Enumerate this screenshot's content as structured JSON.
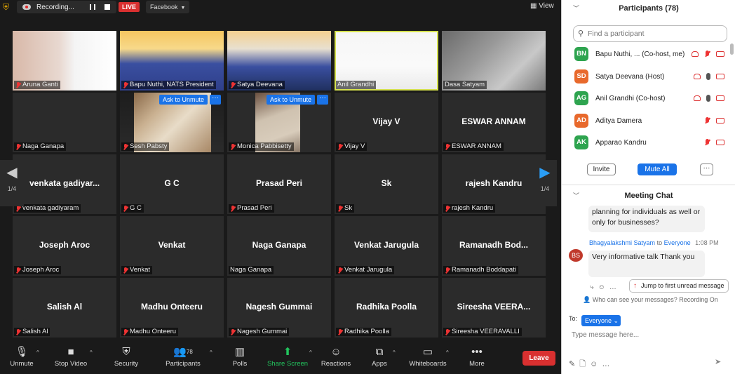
{
  "topbar": {
    "recording_label": "Recording...",
    "live_label": "LIVE",
    "platform_label": "Facebook",
    "view_label": "View"
  },
  "tiles": [
    {
      "name": "Aruna Ganti"
    },
    {
      "name": "Bapu Nuthi, NATS President"
    },
    {
      "name": "Satya Deevana"
    },
    {
      "name": "Anil Grandhi"
    },
    {
      "name": "Dasa Satyam"
    },
    {
      "name": "Naga Ganapa"
    },
    {
      "name": "Sesh Pabsty",
      "ask": "Ask to Unmute"
    },
    {
      "name": "Monica Pabbisetty",
      "ask": "Ask to Unmute"
    },
    {
      "name": "Vijay V",
      "big": "Vijay V"
    },
    {
      "name": "ESWAR ANNAM",
      "big": "ESWAR ANNAM"
    },
    {
      "name": "venkata gadiyaram",
      "big": "venkata  gadiyar..."
    },
    {
      "name": "G C",
      "big": "G C"
    },
    {
      "name": "Prasad Peri",
      "big": "Prasad Peri"
    },
    {
      "name": "Sk",
      "big": "Sk"
    },
    {
      "name": "rajesh Kandru",
      "big": "rajesh Kandru"
    },
    {
      "name": "Joseph Aroc",
      "big": "Joseph Aroc"
    },
    {
      "name": "Venkat",
      "big": "Venkat"
    },
    {
      "name": "Naga Ganapa",
      "big": "Naga Ganapa"
    },
    {
      "name": "Venkat Jarugula",
      "big": "Venkat Jarugula"
    },
    {
      "name": "Ramanadh Boddapati",
      "big": "Ramanadh  Bod..."
    },
    {
      "name": "Salish Al",
      "big": "Salish Al"
    },
    {
      "name": "Madhu Onteeru",
      "big": "Madhu Onteeru"
    },
    {
      "name": "Nagesh Gummai",
      "big": "Nagesh Gummai"
    },
    {
      "name": "Radhika Poolla",
      "big": "Radhika Poolla"
    },
    {
      "name": "Sireesha VEERAVALLI",
      "big": "Sireesha  VEERA..."
    }
  ],
  "pager": {
    "left": "1/4",
    "right": "1/4"
  },
  "toolbar": {
    "unmute": "Unmute",
    "stop_video": "Stop Video",
    "security": "Security",
    "participants": "Participants",
    "participants_count": "78",
    "polls": "Polls",
    "share_screen": "Share Screen",
    "reactions": "Reactions",
    "apps": "Apps",
    "whiteboards": "Whiteboards",
    "more": "More",
    "leave": "Leave"
  },
  "participants_panel": {
    "title": "Participants (78)",
    "search_placeholder": "Find a participant",
    "list": [
      {
        "initials": "BN",
        "color": "#2ea44f",
        "name": "Bapu Nuthi, ... (Co-host, me)"
      },
      {
        "initials": "SD",
        "color": "#e8692c",
        "name": "Satya Deevana (Host)"
      },
      {
        "initials": "AG",
        "color": "#2ea44f",
        "name": "Anil Grandhi (Co-host)"
      },
      {
        "initials": "AD",
        "color": "#e8692c",
        "name": "Aditya Damera"
      },
      {
        "initials": "AK",
        "color": "#2ea44f",
        "name": "Apparao Kandru"
      }
    ],
    "invite": "Invite",
    "mute_all": "Mute All"
  },
  "chat": {
    "title": "Meeting Chat",
    "prev_message": "planning for individuals as well or only for businesses?",
    "sender": "Bhagyalakshmi Satyam",
    "to_word": "to",
    "recipient": "Everyone",
    "time": "1:08 PM",
    "sender_initials": "BS",
    "message": "Very informative talk Thank you",
    "jump_label": "Jump to first unread message",
    "who_can_see": "Who can see your messages? Recording On",
    "to_label": "To:",
    "to_value": "Everyone",
    "input_placeholder": "Type message here..."
  }
}
